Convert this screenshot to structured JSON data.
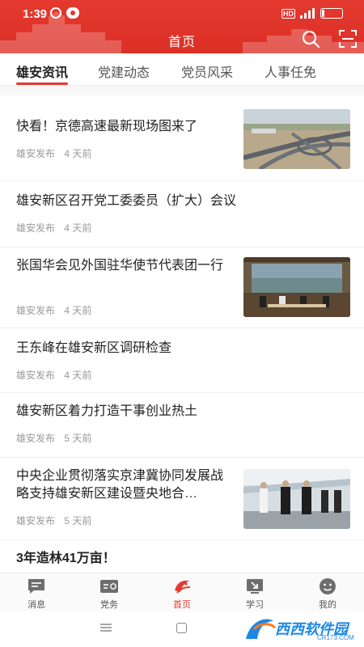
{
  "status_bar": {
    "time": "1:39",
    "battery": "11",
    "battery_level": 0.11,
    "network": "4G",
    "hd_badge": "HD"
  },
  "header": {
    "title": "首页",
    "search_icon": "search-icon",
    "scan_icon": "scan-icon",
    "bg_color": "#e4392f"
  },
  "tabs": [
    {
      "label": "雄安资讯",
      "active": true
    },
    {
      "label": "党建动态",
      "active": false
    },
    {
      "label": "党员风采",
      "active": false
    },
    {
      "label": "人事任免",
      "active": false
    }
  ],
  "news": [
    {
      "title": "快看！京德高速最新现场图来了",
      "source": "雄安发布",
      "time": "4 天前",
      "has_image": true,
      "image": "highway-interchange-photo"
    },
    {
      "title": "雄安新区召开党工委委员（扩大）会议",
      "source": "雄安发布",
      "time": "4 天前",
      "has_image": false
    },
    {
      "title": "张国华会见外国驻华使节代表团一行",
      "source": "雄安发布",
      "time": "4 天前",
      "has_image": true,
      "image": "meeting-room-photo"
    },
    {
      "title": "王东峰在雄安新区调研检查",
      "source": "雄安发布",
      "time": "4 天前",
      "has_image": false
    },
    {
      "title": "雄安新区着力打造干事创业热土",
      "source": "雄安发布",
      "time": "5 天前",
      "has_image": false
    },
    {
      "title": "中央企业贯彻落实京津冀协同发展战略支持雄安新区建设暨央地合…",
      "source": "雄安发布",
      "time": "5 天前",
      "has_image": true,
      "image": "officials-walking-photo"
    },
    {
      "title": "3年造林41万亩！",
      "source": "",
      "time": "",
      "has_image": false
    }
  ],
  "bottom_nav": [
    {
      "label": "消息",
      "icon": "message-icon",
      "active": false
    },
    {
      "label": "党务",
      "icon": "party-affairs-icon",
      "active": false
    },
    {
      "label": "首页",
      "icon": "xiongan-logo-icon",
      "active": true
    },
    {
      "label": "学习",
      "icon": "study-icon",
      "active": false
    },
    {
      "label": "我的",
      "icon": "profile-icon",
      "active": false
    }
  ],
  "watermark": {
    "text": "西西软件园",
    "sub": "CR173.COM"
  },
  "colors": {
    "accent": "#e4392f",
    "text_primary": "#222222",
    "text_secondary": "#999999"
  }
}
